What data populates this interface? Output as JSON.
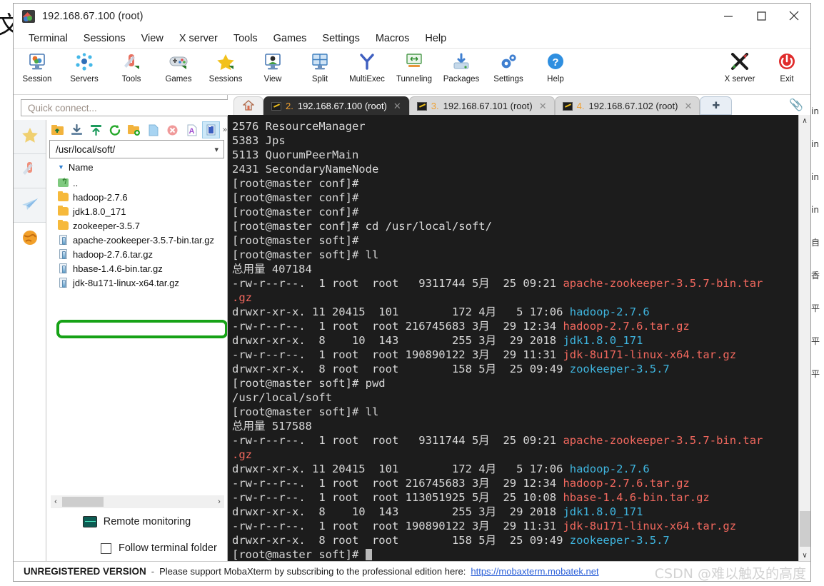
{
  "window": {
    "title": "192.168.67.100 (root)",
    "app_icon": "mobaxterm-icon",
    "minimize": "—",
    "maximize": "□",
    "close": "✕"
  },
  "background": {
    "left_char": "文",
    "right_column": [
      "in",
      "in",
      "in",
      "in",
      "自",
      "香",
      "平",
      "平",
      "平"
    ]
  },
  "menu": {
    "items": [
      "Terminal",
      "Sessions",
      "View",
      "X server",
      "Tools",
      "Games",
      "Settings",
      "Macros",
      "Help"
    ]
  },
  "toolbar": {
    "items": [
      {
        "label": "Session",
        "icon": "session-icon"
      },
      {
        "label": "Servers",
        "icon": "servers-icon"
      },
      {
        "label": "Tools",
        "icon": "tools-icon"
      },
      {
        "label": "Games",
        "icon": "games-icon"
      },
      {
        "label": "Sessions",
        "icon": "sessions-star-icon"
      },
      {
        "label": "View",
        "icon": "view-icon"
      },
      {
        "label": "Split",
        "icon": "split-icon"
      },
      {
        "label": "MultiExec",
        "icon": "multiexec-icon"
      },
      {
        "label": "Tunneling",
        "icon": "tunneling-icon"
      },
      {
        "label": "Packages",
        "icon": "packages-icon"
      },
      {
        "label": "Settings",
        "icon": "settings-gear-icon"
      },
      {
        "label": "Help",
        "icon": "help-icon"
      }
    ],
    "right_items": [
      {
        "label": "X server",
        "icon": "x-server-icon"
      },
      {
        "label": "Exit",
        "icon": "power-exit-icon"
      }
    ]
  },
  "sidebar": {
    "quick_connect_placeholder": "Quick connect...",
    "rail_icons": [
      "star-favorites-icon",
      "tools-knife-icon",
      "send-paperplane-icon",
      "globe-icon"
    ],
    "file_tools": [
      "up-folder-icon",
      "download-icon",
      "upload-icon",
      "refresh-icon",
      "new-folder-icon",
      "new-file-icon",
      "delete-icon",
      "text-mode-icon",
      "view-toggle-icon"
    ],
    "file_tools_overflow": "»",
    "path": "/usr/local/soft/",
    "path_caret": "⌄",
    "column_header": "Name",
    "sort_arrow": "▼",
    "files": [
      {
        "name": "..",
        "type": "up"
      },
      {
        "name": "hadoop-2.7.6",
        "type": "folder"
      },
      {
        "name": "jdk1.8.0_171",
        "type": "folder"
      },
      {
        "name": "zookeeper-3.5.7",
        "type": "folder"
      },
      {
        "name": "apache-zookeeper-3.5.7-bin.tar.gz",
        "type": "file"
      },
      {
        "name": "hadoop-2.7.6.tar.gz",
        "type": "file"
      },
      {
        "name": "hbase-1.4.6-bin.tar.gz",
        "type": "file",
        "highlighted": true
      },
      {
        "name": "jdk-8u171-linux-x64.tar.gz",
        "type": "file"
      }
    ],
    "scroll_left": "‹",
    "scroll_right": "›",
    "remote_monitoring": "Remote monitoring",
    "follow_terminal_folder": "Follow terminal folder",
    "follow_checked": false,
    "annotation_color": "#16a216"
  },
  "tabs": {
    "home_icon": "home-icon",
    "items": [
      {
        "num": "2.",
        "label": "192.168.67.100 (root)",
        "active": true,
        "close": "✕"
      },
      {
        "num": "3.",
        "label": "192.168.67.101 (root)",
        "active": false,
        "close": "✕"
      },
      {
        "num": "4.",
        "label": "192.168.67.102 (root)",
        "active": false,
        "close": "✕"
      }
    ],
    "new_tab": "✚",
    "clip_icon": "paperclip-icon"
  },
  "terminal": {
    "colors": {
      "background": "#1c1c1c",
      "text": "#d8d8d8",
      "directory": "#3fb6e0",
      "archive": "#f2685e"
    },
    "lines": [
      [
        {
          "t": "2576 ResourceManager"
        }
      ],
      [
        {
          "t": "5383 Jps"
        }
      ],
      [
        {
          "t": "5113 QuorumPeerMain"
        }
      ],
      [
        {
          "t": "2431 SecondaryNameNode"
        }
      ],
      [
        {
          "t": "[root@master conf]# "
        }
      ],
      [
        {
          "t": "[root@master conf]# "
        }
      ],
      [
        {
          "t": "[root@master conf]# "
        }
      ],
      [
        {
          "t": "[root@master conf]# cd /usr/local/soft/"
        }
      ],
      [
        {
          "t": "[root@master soft]# "
        }
      ],
      [
        {
          "t": "[root@master soft]# ll"
        }
      ],
      [
        {
          "t": "总用量 407184"
        }
      ],
      [
        {
          "t": "-rw-r--r--.  1 root  root   9311744 5月  25 09:21 "
        },
        {
          "t": "apache-zookeeper-3.5.7-bin.tar",
          "c": "arch"
        }
      ],
      [
        {
          "t": ".gz",
          "c": "arch"
        }
      ],
      [
        {
          "t": "drwxr-xr-x. 11 20415  101        172 4月   5 17:06 "
        },
        {
          "t": "hadoop-2.7.6",
          "c": "dir"
        }
      ],
      [
        {
          "t": "-rw-r--r--.  1 root  root 216745683 3月  29 12:34 "
        },
        {
          "t": "hadoop-2.7.6.tar.gz",
          "c": "arch"
        }
      ],
      [
        {
          "t": "drwxr-xr-x.  8    10  143        255 3月  29 2018 "
        },
        {
          "t": "jdk1.8.0_171",
          "c": "dir"
        }
      ],
      [
        {
          "t": "-rw-r--r--.  1 root  root 190890122 3月  29 11:31 "
        },
        {
          "t": "jdk-8u171-linux-x64.tar.gz",
          "c": "arch"
        }
      ],
      [
        {
          "t": "drwxr-xr-x.  8 root  root        158 5月  25 09:49 "
        },
        {
          "t": "zookeeper-3.5.7",
          "c": "dir"
        }
      ],
      [
        {
          "t": "[root@master soft]# pwd"
        }
      ],
      [
        {
          "t": "/usr/local/soft"
        }
      ],
      [
        {
          "t": "[root@master soft]# ll"
        }
      ],
      [
        {
          "t": "总用量 517588"
        }
      ],
      [
        {
          "t": "-rw-r--r--.  1 root  root   9311744 5月  25 09:21 "
        },
        {
          "t": "apache-zookeeper-3.5.7-bin.tar",
          "c": "arch"
        }
      ],
      [
        {
          "t": ".gz",
          "c": "arch"
        }
      ],
      [
        {
          "t": "drwxr-xr-x. 11 20415  101        172 4月   5 17:06 "
        },
        {
          "t": "hadoop-2.7.6",
          "c": "dir"
        }
      ],
      [
        {
          "t": "-rw-r--r--.  1 root  root 216745683 3月  29 12:34 "
        },
        {
          "t": "hadoop-2.7.6.tar.gz",
          "c": "arch"
        }
      ],
      [
        {
          "t": "-rw-r--r--.  1 root  root 113051925 5月  25 10:08 "
        },
        {
          "t": "hbase-1.4.6-bin.tar.gz",
          "c": "arch"
        }
      ],
      [
        {
          "t": "drwxr-xr-x.  8    10  143        255 3月  29 2018 "
        },
        {
          "t": "jdk1.8.0_171",
          "c": "dir"
        }
      ],
      [
        {
          "t": "-rw-r--r--.  1 root  root 190890122 3月  29 11:31 "
        },
        {
          "t": "jdk-8u171-linux-x64.tar.gz",
          "c": "arch"
        }
      ],
      [
        {
          "t": "drwxr-xr-x.  8 root  root        158 5月  25 09:49 "
        },
        {
          "t": "zookeeper-3.5.7",
          "c": "dir"
        }
      ],
      [
        {
          "t": "[root@master soft]# ",
          "cursor": true
        }
      ]
    ],
    "scroll_up": "∧",
    "scroll_down": "∨"
  },
  "statusbar": {
    "unregistered": "UNREGISTERED VERSION",
    "dash": "-",
    "message": "Please support MobaXterm by subscribing to the professional edition here:",
    "link": "https://mobaxterm.mobatek.net",
    "watermark": "CSDN @难以触及的高度"
  }
}
